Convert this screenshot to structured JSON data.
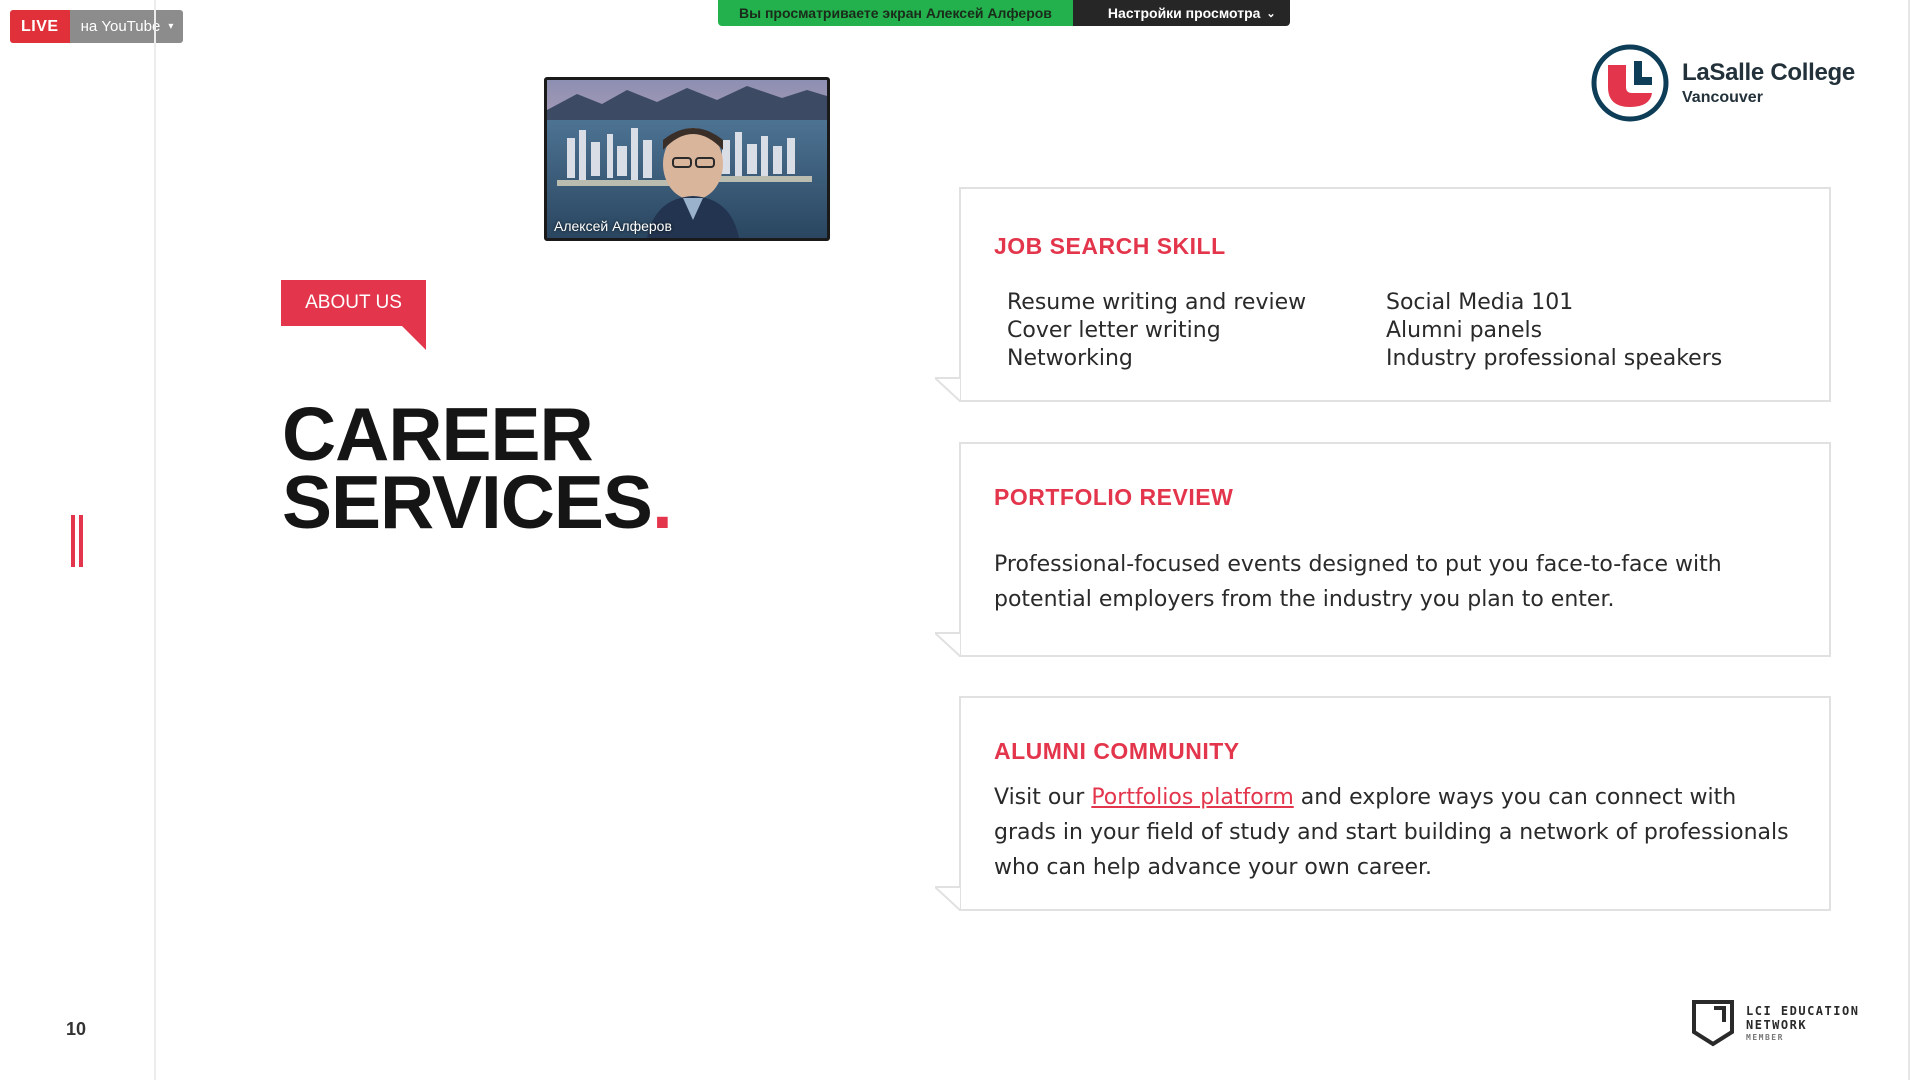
{
  "live": {
    "badge": "LIVE",
    "destination": "на YouTube",
    "caret": "▾"
  },
  "share_bar": {
    "message": "Вы просматриваете экран Алексей Алферов",
    "settings_label": "Настройки просмотра",
    "caret": "⌄"
  },
  "video": {
    "participant_name": "Алексей Алферов"
  },
  "logo": {
    "title": "LaSalle College",
    "subtitle": "Vancouver"
  },
  "slide": {
    "tag": "ABOUT US",
    "title_line1": "CAREER",
    "title_line2": "SERVICES",
    "title_dot": ".",
    "page_number": "10"
  },
  "cards": {
    "job_search": {
      "heading": "JOB SEARCH SKILL",
      "left_items": [
        "Resume writing and review",
        "Cover letter writing",
        "Networking"
      ],
      "right_items": [
        "Social Media 101",
        "Alumni panels",
        "Industry professional speakers"
      ]
    },
    "portfolio": {
      "heading": "PORTFOLIO REVIEW",
      "body": "Professional-focused events designed to put you face-to-face with potential employers from the industry you plan to enter."
    },
    "alumni": {
      "heading": "ALUMNI COMMUNITY",
      "body_before": "Visit our ",
      "link_text": "Portfolios platform",
      "body_after": " and explore ways you can connect with grads in your field of study and start building a network of professionals who can help advance your own career."
    }
  },
  "footer_badge": {
    "line1": "LCI EDUCATION",
    "line2": "NETWORK",
    "line3": "MEMBER"
  },
  "colors": {
    "accent": "#e3354b",
    "live": "#e0313a",
    "share_green": "#22b14c",
    "logo_navy": "#22313a"
  }
}
